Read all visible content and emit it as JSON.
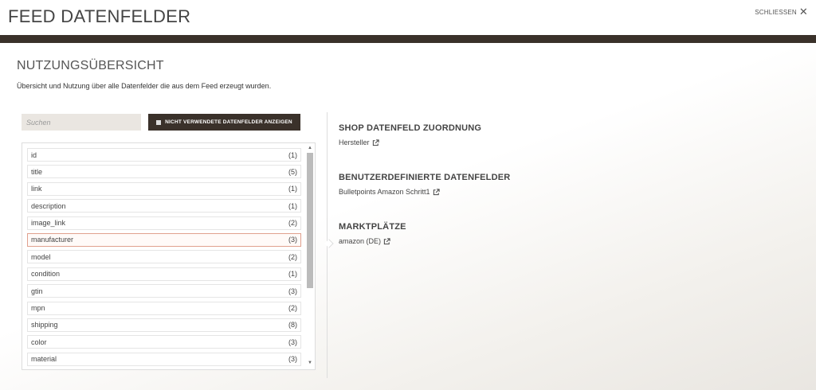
{
  "header": {
    "title": "FEED DATENFELDER",
    "close_label": "SCHLIESSEN"
  },
  "overview": {
    "title": "NUTZUNGSÜBERSICHT",
    "subtitle": "Übersicht und Nutzung über alle Datenfelder die aus dem Feed erzeugt wurden."
  },
  "search": {
    "placeholder": "Suchen",
    "value": ""
  },
  "toggle": {
    "label": "NICHT VERWENDETE DATENFELDER ANZEIGEN",
    "checked": false
  },
  "fields": [
    {
      "name": "id",
      "count": "(1)"
    },
    {
      "name": "title",
      "count": "(5)"
    },
    {
      "name": "link",
      "count": "(1)"
    },
    {
      "name": "description",
      "count": "(1)"
    },
    {
      "name": "image_link",
      "count": "(2)"
    },
    {
      "name": "manufacturer",
      "count": "(3)",
      "selected": true
    },
    {
      "name": "model",
      "count": "(2)"
    },
    {
      "name": "condition",
      "count": "(1)"
    },
    {
      "name": "gtin",
      "count": "(3)"
    },
    {
      "name": "mpn",
      "count": "(2)"
    },
    {
      "name": "shipping",
      "count": "(8)"
    },
    {
      "name": "color",
      "count": "(3)"
    },
    {
      "name": "material",
      "count": "(3)"
    }
  ],
  "details": {
    "shop_mapping": {
      "heading": "SHOP DATENFELD ZUORDNUNG",
      "link": "Hersteller"
    },
    "custom_fields": {
      "heading": "BENUTZERDEFINIERTE DATENFELDER",
      "link": "Bulletpoints Amazon Schritt1"
    },
    "marketplaces": {
      "heading": "MARKTPLÄTZE",
      "link": "amazon (DE)"
    }
  },
  "colors": {
    "dark_brown": "#3a312a",
    "selected_border": "#e0a08e",
    "search_bg": "#eae6e1"
  },
  "icons": {
    "close": "close-icon",
    "external_link": "external-link-icon",
    "checkbox": "checkbox-icon"
  }
}
